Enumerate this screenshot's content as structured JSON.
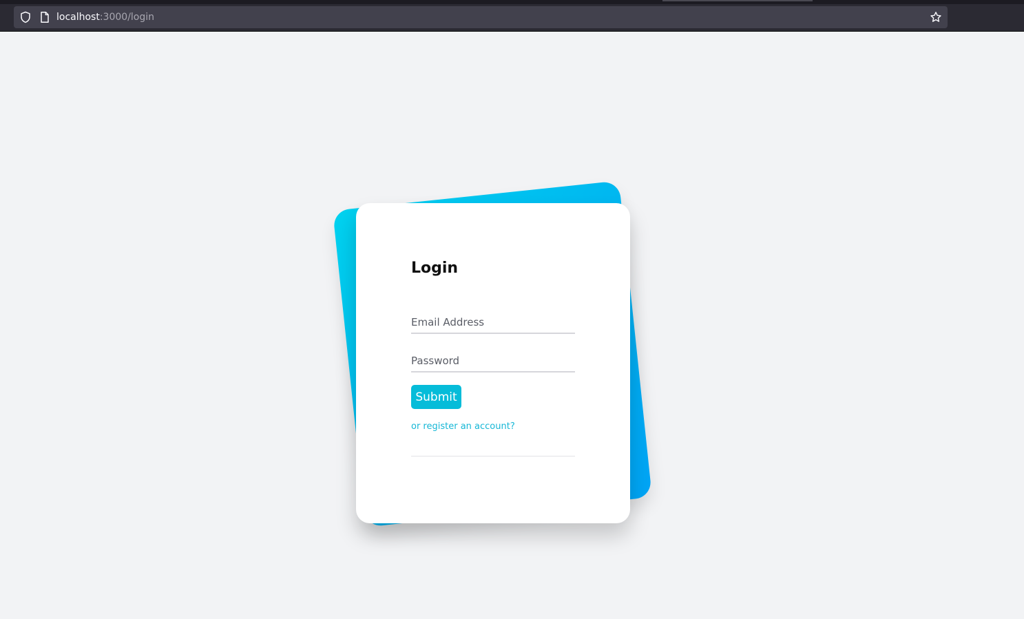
{
  "browser": {
    "url_host": "localhost",
    "url_path": ":3000/login"
  },
  "login": {
    "title": "Login",
    "email_placeholder": "Email Address",
    "password_placeholder": "Password",
    "submit_label": "Submit",
    "register_link": "or register an account?"
  },
  "colors": {
    "accent": "#06bcd9",
    "link": "#16b7d6",
    "gradient_start": "#00d2ef",
    "gradient_end": "#00a4f5",
    "page_bg": "#f2f3f5"
  },
  "icons": {
    "shield": "shield-icon",
    "page": "page-icon",
    "bookmark": "star-icon"
  }
}
